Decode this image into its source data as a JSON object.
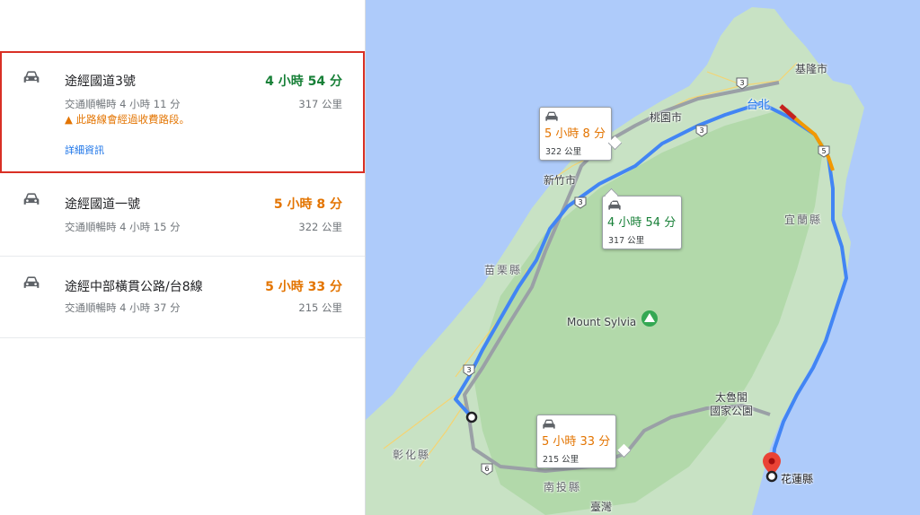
{
  "colors": {
    "green": "#188038",
    "orange": "#e37400",
    "blue": "#1a73e8",
    "grey_route": "#9aa0a6",
    "selected_border": "#d93025"
  },
  "routes": [
    {
      "name": "途經國道3號",
      "time": "4 小時 54 分",
      "time_color": "green",
      "traffic": "交通順暢時 4 小時 11 分",
      "distance": "317 公里",
      "warning": "此路線會經過收費路段。",
      "details_link": "詳細資訊",
      "icon": "car-icon",
      "selected": true
    },
    {
      "name": "途經國道一號",
      "time": "5 小時 8 分",
      "time_color": "orange",
      "traffic": "交通順暢時 4 小時 15 分",
      "distance": "322 公里",
      "icon": "car-icon",
      "selected": false
    },
    {
      "name": "途經中部橫貫公路/台8線",
      "time": "5 小時 33 分",
      "time_color": "orange",
      "traffic": "交通順暢時 4 小時 37 分",
      "distance": "215 公里",
      "icon": "car-icon",
      "selected": false
    }
  ],
  "map": {
    "callouts": [
      {
        "time": "5 小時 8 分",
        "distance": "322 公里",
        "color": "orange"
      },
      {
        "time": "4 小時 54 分",
        "distance": "317 公里",
        "color": "green"
      },
      {
        "time": "5 小時 33 分",
        "distance": "215 公里",
        "color": "orange"
      }
    ],
    "labels": {
      "keelung": "基隆市",
      "taipei": "台北",
      "taoyuan": "桃園市",
      "hsinchu": "新竹市",
      "yilan": "宜蘭縣",
      "miaoli": "苗栗縣",
      "mount_sylvia": "Mount Sylvia",
      "taroko": "太魯閣\n國家公園",
      "changhua": "彰化縣",
      "nantou": "南投縣",
      "taiwan": "臺灣",
      "destination": "花蓮縣"
    },
    "shields": [
      "3",
      "5",
      "3",
      "3",
      "3",
      "6"
    ]
  }
}
